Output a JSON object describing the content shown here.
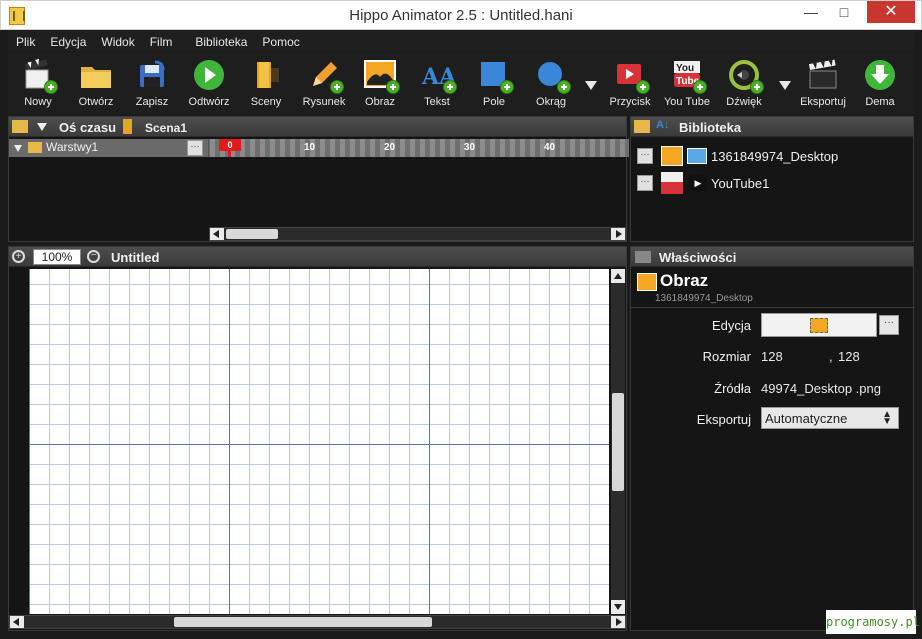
{
  "window": {
    "title": "Hippo Animator 2.5 : Untitled.hani",
    "min": "—",
    "max": "□",
    "close": "✕"
  },
  "menu": [
    "Plik",
    "Edycja",
    "Widok",
    "Film",
    "Biblioteka",
    "Pomoc"
  ],
  "toolbar": {
    "new": "Nowy",
    "open": "Otwórz",
    "save": "Zapisz",
    "play": "Odtwórz",
    "scenes": "Sceny",
    "draw": "Rysunek",
    "image": "Obraz",
    "text": "Tekst",
    "field": "Pole",
    "circle": "Okrąg",
    "button": "Przycisk",
    "youtube": "You Tube",
    "sound": "Dźwięk",
    "export": "Eksportuj",
    "demo": "Dema"
  },
  "timeline": {
    "title": "Oś czasu",
    "scene": "Scena1",
    "layer": "Warstwy1",
    "playhead": "0",
    "frame_labels": [
      "10",
      "20",
      "30",
      "40"
    ],
    "dots": "···"
  },
  "library": {
    "title": "Biblioteka",
    "items": [
      {
        "label": "1361849974_Desktop"
      },
      {
        "label": "YouTube1"
      }
    ],
    "dots": "···"
  },
  "stage": {
    "zoom": "100%",
    "title": "Untitled"
  },
  "properties": {
    "title": "Właściwości",
    "object_type": "Obraz",
    "object_name": "1361849974_Desktop",
    "edit_label": "Edycja",
    "size_label": "Rozmiar",
    "size_w": "128",
    "size_sep": ",",
    "size_h": "128",
    "source_label": "Źródła",
    "source_value": "49974_Desktop .png",
    "export_label": "Eksportuj",
    "export_value": "Automatyczne",
    "dots": "···"
  },
  "watermark": "programosy.pl"
}
